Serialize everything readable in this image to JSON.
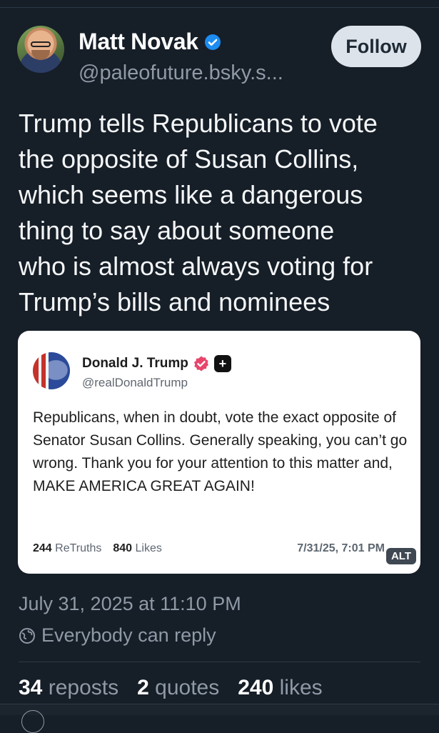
{
  "author": {
    "name": "Matt Novak",
    "handle": "@paleofuture.bsky.s...",
    "verified_icon": "verified-check-icon"
  },
  "follow_button": {
    "label": "Follow"
  },
  "post": {
    "text": "Trump tells Republicans to vote\nthe opposite of Susan Collins,\nwhich seems like a dangerous\nthing to say about someone\nwho is almost always voting for\nTrump’s bills and nominees"
  },
  "embed": {
    "name": "Donald J. Trump",
    "handle": "@realDonaldTrump",
    "text": "Republicans, when in doubt, vote the exact opposite of Senator Susan Collins. Generally speaking, you can’t go wrong. Thank you for your attention to this matter and, MAKE AMERICA GREAT AGAIN!",
    "retruths_count": "244",
    "retruths_label": "ReTruths",
    "likes_count": "840",
    "likes_label": "Likes",
    "date": "7/31/25, 7:01 PM",
    "alt_label": "ALT"
  },
  "meta": {
    "timestamp": "July 31, 2025 at 11:10 PM",
    "reply_setting": "Everybody can reply"
  },
  "stats": {
    "reposts_count": "34",
    "reposts_label": "reposts",
    "quotes_count": "2",
    "quotes_label": "quotes",
    "likes_count": "240",
    "likes_label": "likes"
  },
  "colors": {
    "background": "#161e27",
    "verified_blue": "#1d8cf0",
    "truth_badge": "#e8456b"
  }
}
